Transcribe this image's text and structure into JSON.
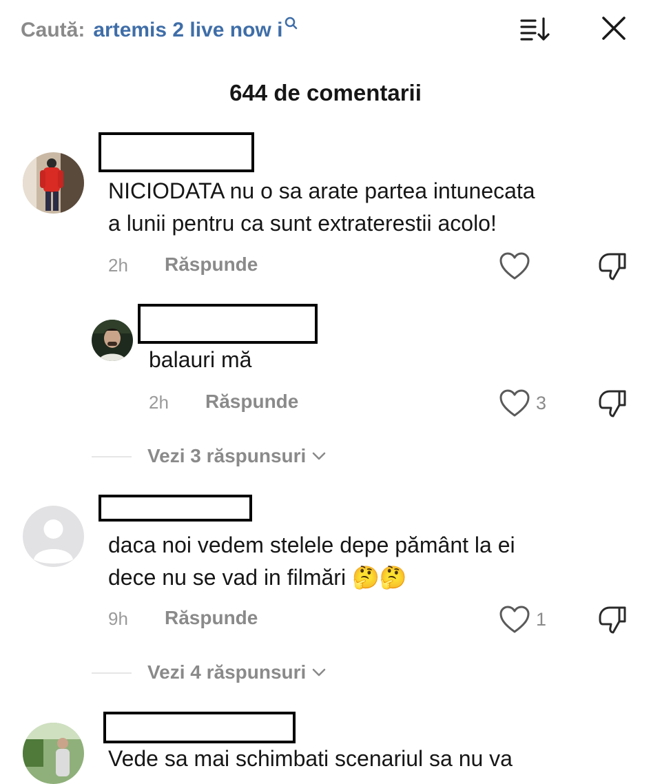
{
  "header": {
    "search_prefix": "Caută:",
    "search_query": "artemis 2 live now i",
    "comments_title": "644 de comentarii"
  },
  "comments": [
    {
      "text_line1": "NICIODATA nu o sa arate partea intunecata",
      "text_line2": "a lunii pentru ca sunt extraterestii acolo!",
      "time": "2h",
      "reply_label": "Răspunde",
      "likes": ""
    },
    {
      "text_line1": "balauri mă",
      "time": "2h",
      "reply_label": "Răspunde",
      "likes": "3",
      "view_replies": "Vezi 3 răspunsuri"
    },
    {
      "text_line1": "daca noi vedem stelele depe pământ la ei",
      "text_line2": "dece nu se vad in filmări 🤔🤔",
      "time": "9h",
      "reply_label": "Răspunde",
      "likes": "1",
      "view_replies": "Vezi 4 răspunsuri"
    },
    {
      "text_line1": "Vede sa mai schimbati scenariul sa nu va"
    }
  ],
  "icons": [
    "search-icon",
    "sort-icon",
    "close-icon",
    "heart-icon",
    "dislike-icon",
    "chevron-down-icon",
    "default-avatar-icon"
  ],
  "colors": {
    "query": "#3f6ea8",
    "muted": "#8a8a8a",
    "text": "#161616"
  }
}
